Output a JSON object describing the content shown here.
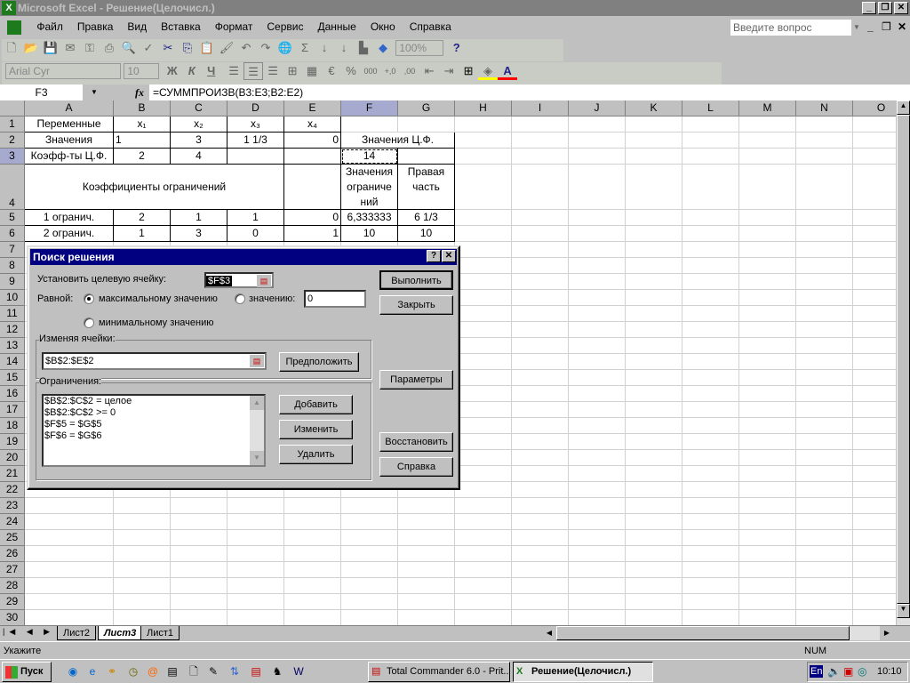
{
  "window": {
    "title": "Microsoft Excel - Решение(Целочисл.)",
    "help_placeholder": "Введите вопрос"
  },
  "menu": [
    "Файл",
    "Правка",
    "Вид",
    "Вставка",
    "Формат",
    "Сервис",
    "Данные",
    "Окно",
    "Справка"
  ],
  "toolbar": {
    "zoom": "100%",
    "font": "Arial Cyr",
    "size": "10",
    "bold": "Ж",
    "italic": "К",
    "underline": "Ч"
  },
  "formula": {
    "name_box": "F3",
    "fx": "fx",
    "content": "=СУММПРОИЗВ(B3:E3;B2:E2)"
  },
  "columns": [
    "A",
    "B",
    "C",
    "D",
    "E",
    "F",
    "G",
    "H",
    "I",
    "J",
    "K",
    "L",
    "M",
    "N",
    "O"
  ],
  "rows_count": 31,
  "cells": {
    "A1": "Переменные",
    "B1": "x₁",
    "C1": "x₂",
    "D1": "x₃",
    "E1": "x₄",
    "A2": "Значения",
    "B2": "1",
    "C2": "3",
    "D2": "1 1/3",
    "E2": "0",
    "F2": "Значения Ц.Ф.",
    "A3": "Коэфф-ты Ц.Ф.",
    "B3": "2",
    "C3": "4",
    "F3": "14",
    "A4": "Коэффициенты ограничений",
    "F4": "Значения ограниче ний",
    "G4": "Правая часть",
    "A5": "1 огранич.",
    "B5": "2",
    "C5": "1",
    "D5": "1",
    "E5": "0",
    "F5": "6,333333",
    "G5": "6 1/3",
    "A6": "2 огранич.",
    "B6": "1",
    "C6": "3",
    "D6": "0",
    "E6": "1",
    "F6": "10",
    "G6": "10"
  },
  "dialog": {
    "title": "Поиск решения",
    "target_label": "Установить целевую ячейку:",
    "target_value": "$F$3",
    "equal_label": "Равной:",
    "max_label": "максимальному значению",
    "value_label": "значению:",
    "value_input": "0",
    "min_label": "минимальному значению",
    "changing_label": "Изменяя ячейки:",
    "changing_value": "$B$2:$E$2",
    "constraints_label": "Ограничения:",
    "constraints": [
      "$B$2:$C$2 = целое",
      "$B$2:$C$2 >= 0",
      "$F$5 = $G$5",
      "$F$6 = $G$6"
    ],
    "buttons": {
      "run": "Выполнить",
      "close": "Закрыть",
      "guess": "Предположить",
      "options": "Параметры",
      "add": "Добавить",
      "change": "Изменить",
      "delete": "Удалить",
      "reset": "Восстановить",
      "help": "Справка"
    }
  },
  "sheets": [
    "Лист2",
    "Лист3",
    "Лист1"
  ],
  "status": {
    "text": "Укажите",
    "num": "NUM"
  },
  "taskbar": {
    "start": "Пуск",
    "tasks": [
      "Total Commander 6.0 - Prit...",
      "Решение(Целочисл.)"
    ],
    "lang": "En",
    "clock": "10:10"
  }
}
